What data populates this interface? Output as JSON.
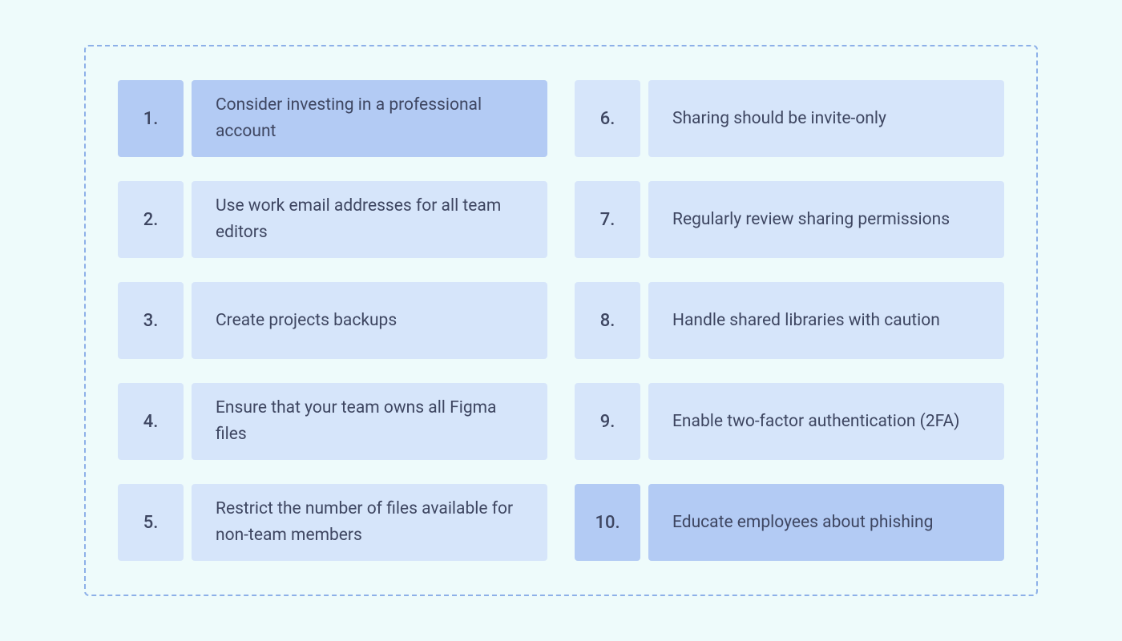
{
  "colors": {
    "page_bg": "#eefbfb",
    "border": "#8db0e8",
    "text": "#3e4661",
    "bg_dark": "#b3cbf4",
    "bg_light": "#d6e5fa"
  },
  "items": [
    {
      "n": "1.",
      "text": "Consider investing in a professional account",
      "highlight": true
    },
    {
      "n": "2.",
      "text": "Use work email addresses for all team editors",
      "highlight": false
    },
    {
      "n": "3.",
      "text": "Create projects backups",
      "highlight": false
    },
    {
      "n": "4.",
      "text": "Ensure that your team owns all Figma files",
      "highlight": false
    },
    {
      "n": "5.",
      "text": "Restrict the number of files available for non-team members",
      "highlight": false
    },
    {
      "n": "6.",
      "text": "Sharing should be invite-only",
      "highlight": false
    },
    {
      "n": "7.",
      "text": "Regularly review sharing permissions",
      "highlight": false
    },
    {
      "n": "8.",
      "text": "Handle shared libraries with caution",
      "highlight": false
    },
    {
      "n": "9.",
      "text": "Enable two-factor authentication (2FA)",
      "highlight": false
    },
    {
      "n": "10.",
      "text": "Educate employees about phishing",
      "highlight": true
    }
  ]
}
